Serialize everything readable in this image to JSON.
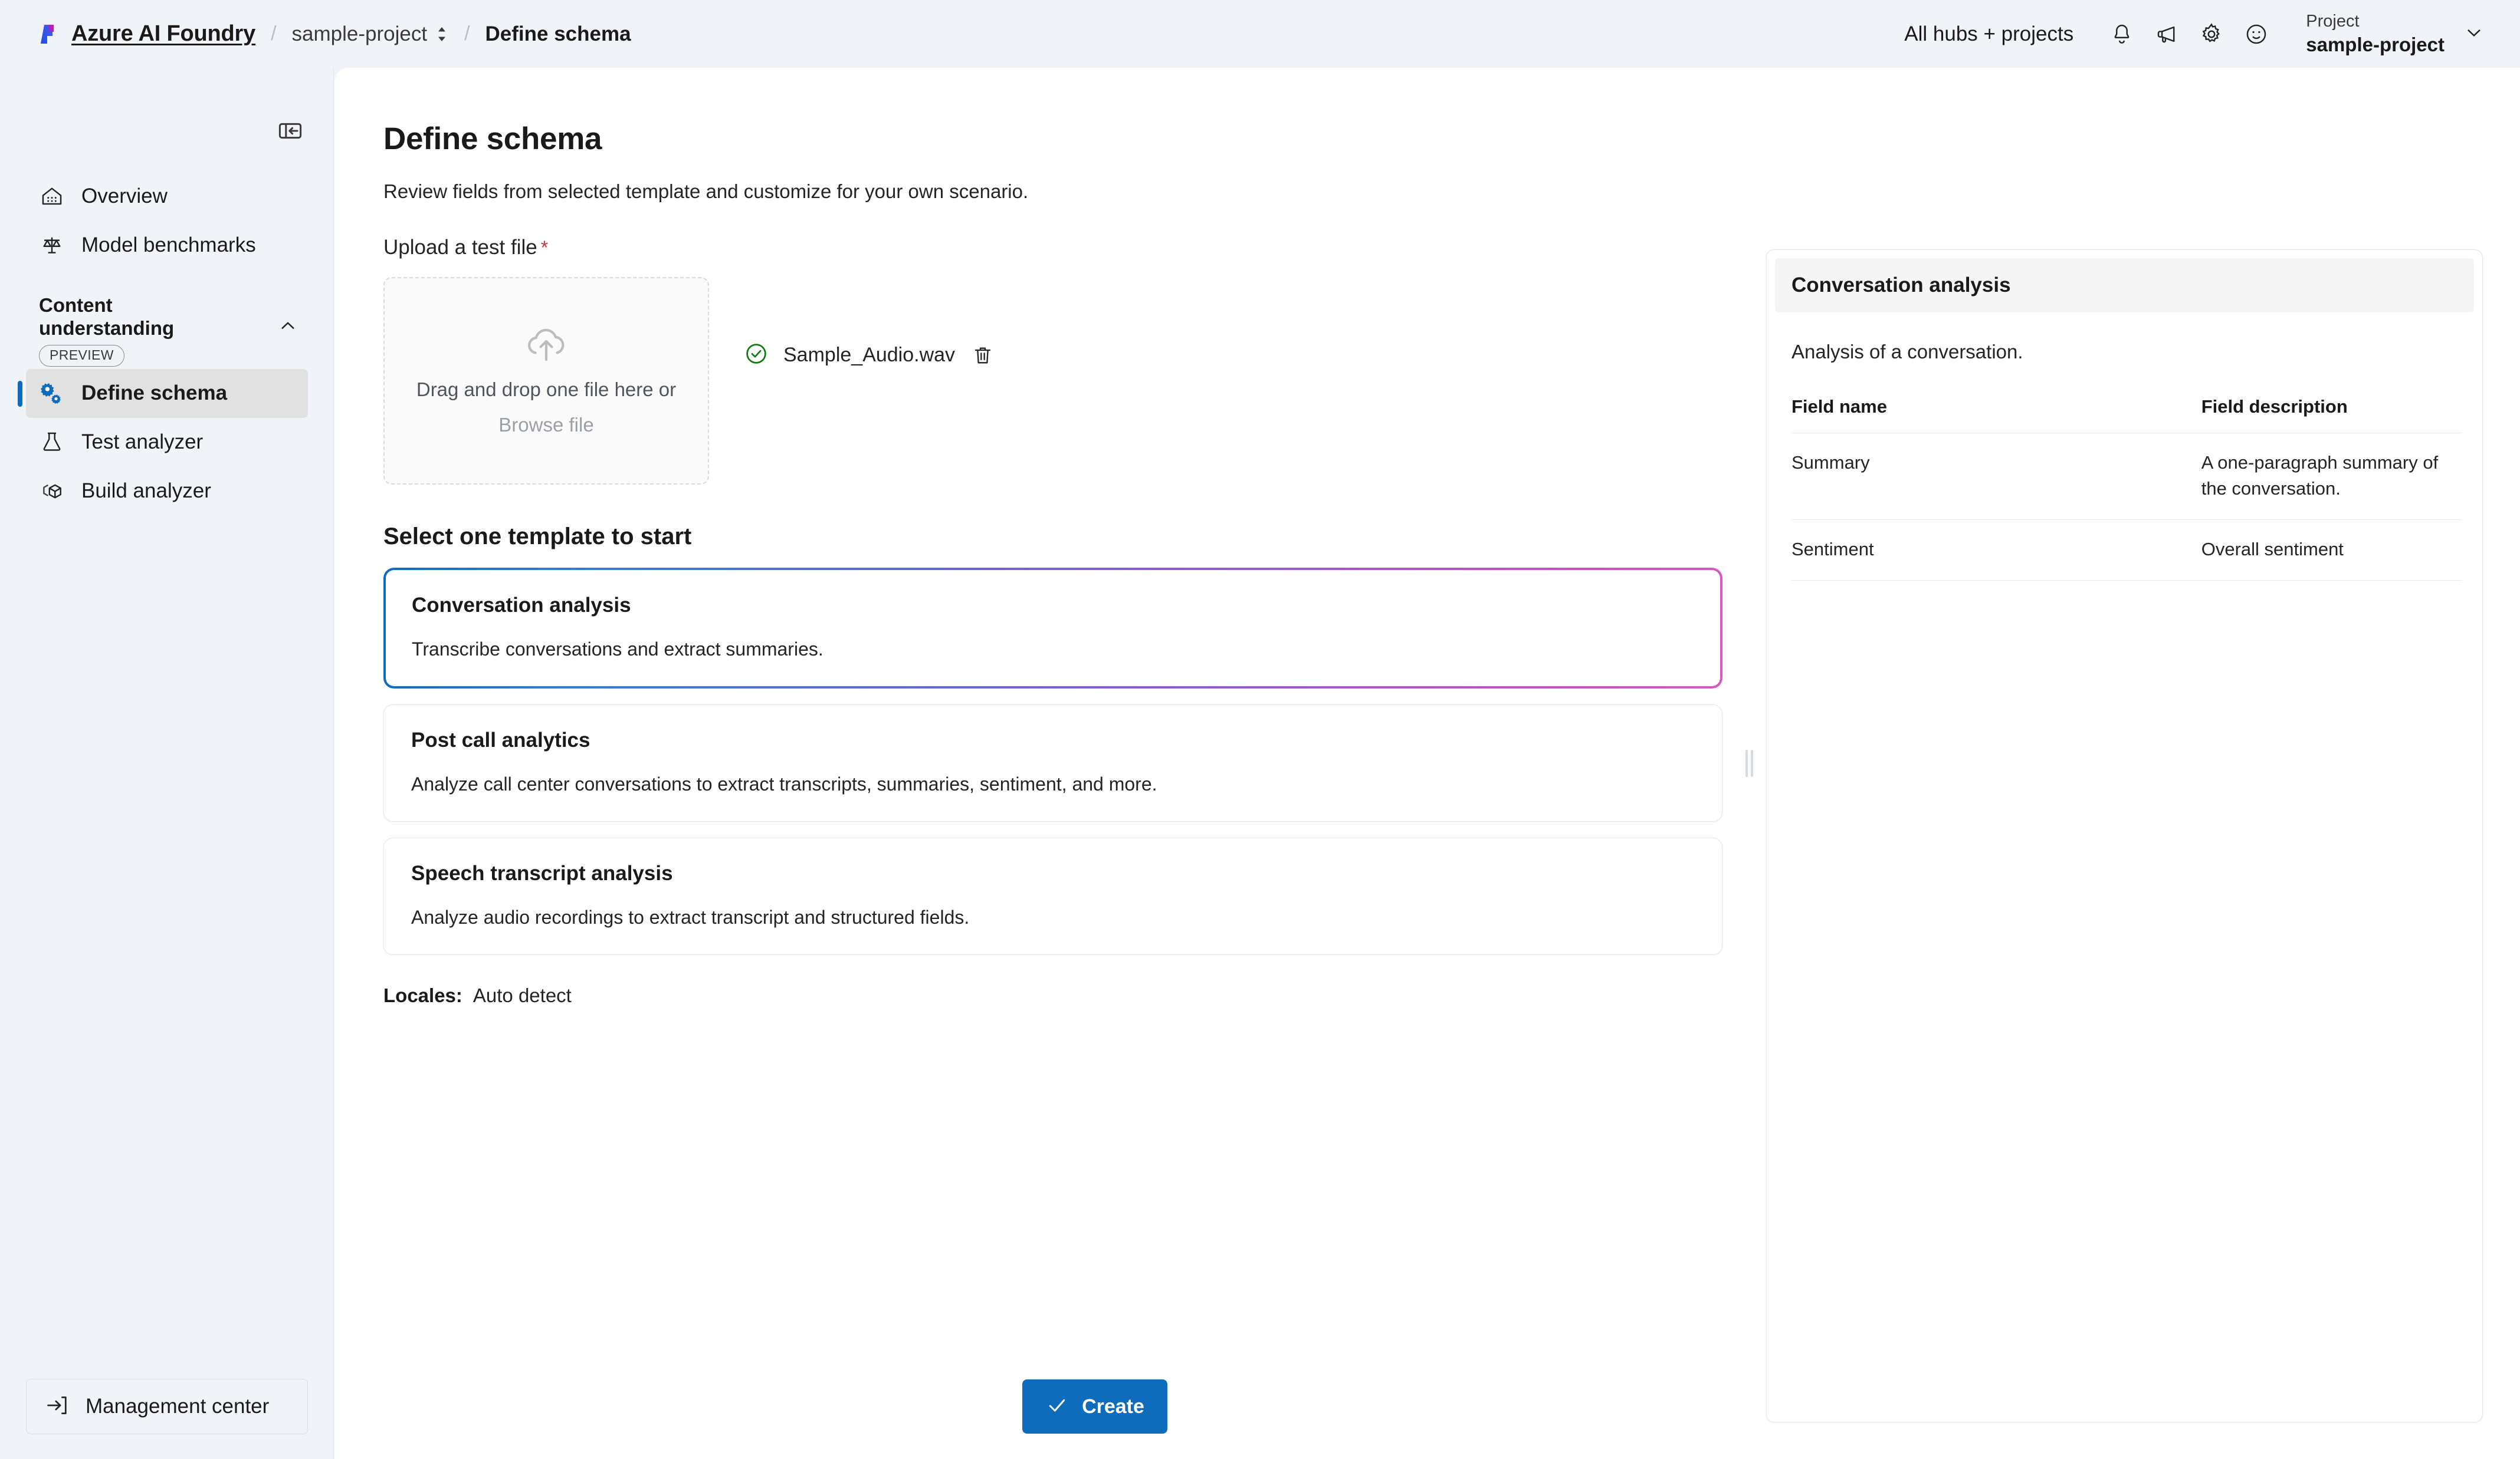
{
  "topbar": {
    "brand": "Azure AI Foundry",
    "logo_icon": "azure-ai-foundry-logo",
    "breadcrumb": [
      {
        "label": "sample-project",
        "icon": "swap-vertical-icon"
      },
      {
        "label": "Define schema",
        "icon": ""
      }
    ],
    "hubs_link": "All hubs + projects",
    "icons": [
      {
        "name": "bell-icon",
        "glyph": "notifications"
      },
      {
        "name": "megaphone-icon",
        "glyph": "announcements"
      },
      {
        "name": "gear-icon",
        "glyph": "settings"
      },
      {
        "name": "smiley-icon",
        "glyph": "feedback"
      }
    ],
    "project_label": "Project",
    "project_value": "sample-project",
    "project_chevron_icon": "chevron-down-icon"
  },
  "sidebar": {
    "collapse_icon": "panel-collapse-icon",
    "items": [
      {
        "label": "Overview",
        "icon": "home-icon",
        "active": false
      },
      {
        "label": "Model benchmarks",
        "icon": "scales-icon",
        "active": false
      }
    ],
    "group": {
      "title": "Content understanding",
      "badge": "PREVIEW",
      "chevron_icon": "chevron-up-icon",
      "items": [
        {
          "label": "Define schema",
          "icon": "cogs-icon",
          "active": true
        },
        {
          "label": "Test analyzer",
          "icon": "beaker-icon",
          "active": false
        },
        {
          "label": "Build analyzer",
          "icon": "cube-icon",
          "active": false
        }
      ]
    },
    "management_center": {
      "label": "Management center",
      "icon": "sign-in-icon"
    }
  },
  "main": {
    "title": "Define schema",
    "subtitle": "Review fields from selected template and customize for your own scenario.",
    "upload_label": "Upload a test file",
    "required_marker": "*",
    "dropzone": {
      "icon": "cloud-upload-icon",
      "primary_text": "Drag and drop one file here or",
      "browse_text": "Browse file"
    },
    "uploaded_file": {
      "status_icon": "checkmark-circle-icon",
      "name": "Sample_Audio.wav",
      "delete_icon": "trash-icon"
    },
    "templates_heading": "Select one template to start",
    "templates": [
      {
        "title": "Conversation analysis",
        "description": "Transcribe conversations and extract summaries.",
        "selected": true
      },
      {
        "title": "Post call analytics",
        "description": "Analyze call center conversations to extract transcripts, summaries, sentiment, and more.",
        "selected": false
      },
      {
        "title": "Speech transcript analysis",
        "description": "Analyze audio recordings to extract transcript and structured fields.",
        "selected": false
      }
    ],
    "locales_label": "Locales:",
    "locales_value": "Auto detect",
    "create_button": {
      "label": "Create",
      "icon": "checkmark-icon"
    }
  },
  "side_panel": {
    "title": "Conversation analysis",
    "description": "Analysis of a conversation.",
    "table": {
      "headers": [
        "Field name",
        "Field description"
      ],
      "rows": [
        {
          "name": "Summary",
          "description": "A one-paragraph summary of the conversation."
        },
        {
          "name": "Sentiment",
          "description": "Overall sentiment"
        }
      ]
    }
  },
  "splitter": {
    "icon": "vertical-grip-icon"
  },
  "colors": {
    "accent_blue": "#0F6CBD",
    "sidebar_bg": "#F0F3F7",
    "canvas_bg": "#FFFFFF",
    "selected_card_gradient_start": "#0F6CBD",
    "selected_card_gradient_end": "#D659C6",
    "required_star": "#D13438",
    "success_green": "#107C10"
  }
}
